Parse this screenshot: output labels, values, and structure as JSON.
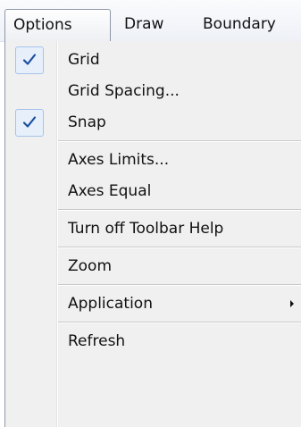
{
  "menubar": {
    "items": [
      {
        "label": "Options"
      },
      {
        "label": "Draw"
      },
      {
        "label": "Boundary"
      }
    ]
  },
  "options_menu": {
    "items": [
      {
        "label": "Grid",
        "checked": true,
        "icon": "check-icon"
      },
      {
        "label": "Grid Spacing...",
        "checked": false
      },
      {
        "label": "Snap",
        "checked": true,
        "icon": "check-icon"
      },
      {
        "label": "Axes Limits...",
        "checked": false
      },
      {
        "label": "Axes Equal",
        "checked": false
      },
      {
        "label": "Turn off Toolbar Help",
        "checked": false
      },
      {
        "label": "Zoom",
        "checked": false
      },
      {
        "label": "Application",
        "checked": false,
        "submenu": true,
        "icon": "submenu-arrow-icon"
      },
      {
        "label": "Refresh",
        "checked": false
      }
    ]
  },
  "colors": {
    "check_accent": "#1a4fa0",
    "check_highlight_bg": "#e7effa",
    "menu_bg": "#f0f0f0"
  }
}
